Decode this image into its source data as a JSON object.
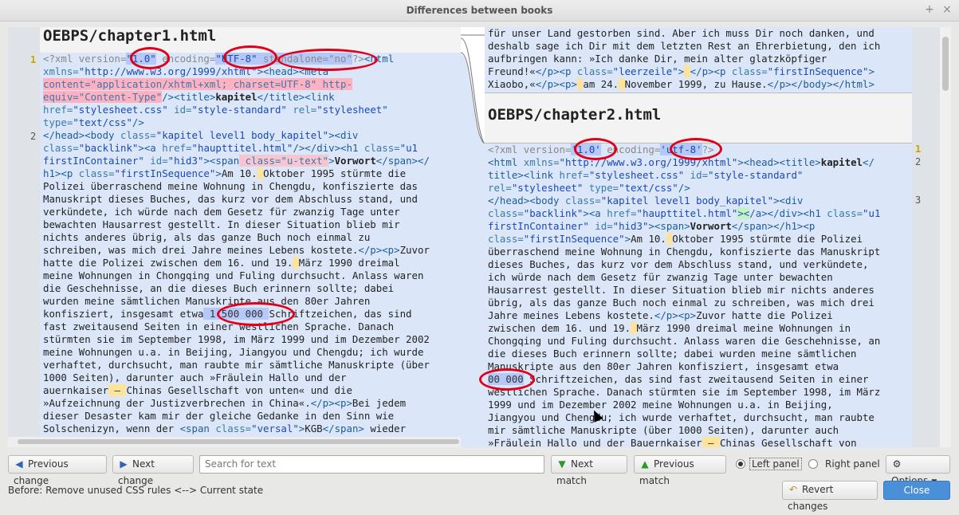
{
  "window": {
    "title": "Differences between books",
    "min_icon": "+",
    "close_icon": "×"
  },
  "left": {
    "filename": "OEBPS/chapter1.html",
    "gutter": [
      "1",
      "2"
    ],
    "lines": [
      [
        [
          "pi",
          "<?xml version="
        ],
        [
          "chg t-str",
          "\"1.0\""
        ],
        [
          "pi",
          " encoding="
        ],
        [
          "chg t-str",
          "\"UTF-8\""
        ],
        [
          "chg t-pi",
          " standalone=\"no\""
        ],
        [
          "pi",
          "?>"
        ],
        [
          "tag",
          "<html"
        ]
      ],
      [
        [
          "attr",
          "xmlns="
        ],
        [
          "str",
          "\"http://www.w3.org/1999/xhtml\""
        ],
        [
          "tag",
          "><head><meta"
        ]
      ],
      [
        [
          "del",
          "content=\"application/xhtml+xml; charset=UTF-8\" http-"
        ]
      ],
      [
        [
          "del",
          "equiv=\"Content-Type\""
        ],
        [
          "tag",
          "/><title>"
        ],
        [
          "bold",
          "kapitel"
        ],
        [
          "tag",
          "</title><link"
        ]
      ],
      [
        [
          "attr",
          "href="
        ],
        [
          "str",
          "\"stylesheet.css\""
        ],
        [
          "attr",
          " id="
        ],
        [
          "str",
          "\"style-standard\""
        ],
        [
          "attr",
          " rel="
        ],
        [
          "str",
          "\"stylesheet\""
        ]
      ],
      [
        [
          "attr",
          "type="
        ],
        [
          "str",
          "\"text/css\""
        ],
        [
          "tag",
          "/>"
        ]
      ],
      [
        [
          "tag",
          "</head><body"
        ],
        [
          "attr",
          " class="
        ],
        [
          "str",
          "\"kapitel level1 body_kapitel\""
        ],
        [
          "tag",
          "><div"
        ]
      ],
      [
        [
          "attr",
          "class="
        ],
        [
          "str",
          "\"backlink\""
        ],
        [
          "tag",
          "><a"
        ],
        [
          "attr",
          " href="
        ],
        [
          "str",
          "\"haupttitel.html\""
        ],
        [
          "tag",
          "/></div><h1"
        ],
        [
          "attr",
          " class="
        ],
        [
          "str",
          "\"u1"
        ]
      ],
      [
        [
          "str",
          "firstInContainer\""
        ],
        [
          "attr",
          " id="
        ],
        [
          "str",
          "\"hid3\""
        ],
        [
          "tag",
          "><span"
        ],
        [
          "rd",
          " class=\"u-text\""
        ],
        [
          "tag",
          ">"
        ],
        [
          "bold",
          "Vorwort"
        ],
        [
          "tag",
          "</span></"
        ]
      ],
      [
        [
          "tag",
          "h1><p"
        ],
        [
          "attr",
          " class="
        ],
        [
          "str",
          "\"firstInSequence\""
        ],
        [
          "tag",
          ">"
        ],
        [
          "txt",
          "Am 10."
        ],
        [
          "dot",
          " "
        ],
        [
          "txt",
          "Oktober 1995 stürmte die"
        ]
      ],
      [
        [
          "txt",
          "Polizei überraschend meine Wohnung in Chengdu, konfiszierte das"
        ]
      ],
      [
        [
          "txt",
          "Manuskript dieses Buches, das kurz vor dem Abschluss stand, und"
        ]
      ],
      [
        [
          "txt",
          "verkündete, ich würde nach dem Gesetz für zwanzig Tage unter"
        ]
      ],
      [
        [
          "txt",
          "bewachten Hausarrest gestellt. In dieser Situation blieb mir"
        ]
      ],
      [
        [
          "txt",
          "nichts anderes übrig, als das ganze Buch noch einmal zu"
        ]
      ],
      [
        [
          "txt",
          "schreiben, was mich drei Jahre meines Lebens kostete."
        ],
        [
          "tag",
          "</p><p>"
        ],
        [
          "txt",
          "Zuvor"
        ]
      ],
      [
        [
          "txt",
          "hatte die Polizei zwischen dem 16. und 19."
        ],
        [
          "dot",
          " "
        ],
        [
          "txt",
          "März 1990 dreimal"
        ]
      ],
      [
        [
          "txt",
          "meine Wohnungen in Chongqing und Fuling durchsucht. Anlass waren"
        ]
      ],
      [
        [
          "txt",
          "die Geschehnisse, an die dieses Buch erinnern sollte; dabei"
        ]
      ],
      [
        [
          "txt",
          "wurden meine sämtlichen Manuskripte aus den 80er Jahren"
        ]
      ],
      [
        [
          "txt",
          "konfisziert, insgesamt etwa"
        ],
        [
          "chg",
          " 1 500 000 "
        ],
        [
          "txt",
          "Schriftzeichen, das sind"
        ]
      ],
      [
        [
          "txt",
          "fast zweitausend Seiten in einer westlichen Sprache. Danach"
        ]
      ],
      [
        [
          "txt",
          "stürmten sie im September 1998, im März 1999 und im Dezember 2002"
        ]
      ],
      [
        [
          "txt",
          "meine Wohnungen u.a. in Beijing, Jiangyou und Chengdu; ich wurde"
        ]
      ],
      [
        [
          "txt",
          "verhaftet, durchsucht, man raubte mir sämtliche Manuskripte (über"
        ]
      ],
      [
        [
          "txt",
          "1000 Seiten), darunter auch »Fräulein Hallo und der"
        ]
      ],
      [
        [
          "txt",
          "auernkaiser"
        ],
        [
          "dot",
          " – "
        ],
        [
          "txt",
          "Chinas Gesellschaft von unten« und die"
        ]
      ],
      [
        [
          "txt",
          "»Aufzeichnung der Justizverbrechen in China«."
        ],
        [
          "tag",
          "</p><p>"
        ],
        [
          "txt",
          "Bei jedem"
        ]
      ],
      [
        [
          "txt",
          "dieser Desaster kam mir der gleiche Gedanke in den Sinn wie"
        ]
      ],
      [
        [
          "txt",
          "Solschenizyn, wenn der "
        ],
        [
          "tag",
          "<span"
        ],
        [
          "attr",
          " class="
        ],
        [
          "str",
          "\"versal\""
        ],
        [
          "tag",
          ">"
        ],
        [
          "txt",
          "KGB"
        ],
        [
          "tag",
          "</span>"
        ],
        [
          "txt",
          " wieder"
        ]
      ]
    ]
  },
  "right": {
    "filename": "OEBPS/chapter2.html",
    "gutter": [
      "1",
      "2",
      "3"
    ],
    "top_lines": [
      [
        [
          "txt",
          "für unser Land gestorben sind. Aber ich muss Dir noch danken, und"
        ]
      ],
      [
        [
          "txt",
          "deshalb sage ich Dir mit dem letzten Rest an Ehrerbietung, den ich"
        ]
      ],
      [
        [
          "txt",
          "aufbringen kann: »Ich danke Dir, mein alter glatzköpfiger"
        ]
      ],
      [
        [
          "txt",
          "Freund!«"
        ],
        [
          "tag",
          "</p><p"
        ],
        [
          "attr",
          " class="
        ],
        [
          "str",
          "\"leerzeile\""
        ],
        [
          "tag",
          ">"
        ],
        [
          "dot",
          " "
        ],
        [
          "tag",
          "</p><p"
        ],
        [
          "attr",
          " class="
        ],
        [
          "str",
          "\"firstInSequence\""
        ],
        [
          "tag",
          ">"
        ]
      ],
      [
        [
          "txt",
          "Xiaobo,«"
        ],
        [
          "tag",
          "</p><p>"
        ],
        [
          "dot",
          " "
        ],
        [
          "txt",
          "am 24."
        ],
        [
          "dot",
          " "
        ],
        [
          "txt",
          "November 1999, zu Hause."
        ],
        [
          "tag",
          "</p></body></html>"
        ]
      ]
    ],
    "lines": [
      [
        [
          "pi",
          "<?xml version="
        ],
        [
          "chg t-str",
          "'1.0'"
        ],
        [
          "pi",
          " encoding="
        ],
        [
          "chg t-str",
          "'utf-8'"
        ],
        [
          "pi",
          "?>"
        ]
      ],
      [
        [
          "tag",
          "<html"
        ],
        [
          "attr",
          " xmlns="
        ],
        [
          "str",
          "\"http://www.w3.org/1999/xhtml\""
        ],
        [
          "tag",
          "><head><title>"
        ],
        [
          "bold",
          "kapitel"
        ],
        [
          "tag",
          "</"
        ]
      ],
      [
        [
          "tag",
          "title><link"
        ],
        [
          "attr",
          " href="
        ],
        [
          "str",
          "\"stylesheet.css\""
        ],
        [
          "attr",
          " id="
        ],
        [
          "str",
          "\"style-standard\""
        ]
      ],
      [
        [
          "attr",
          "rel="
        ],
        [
          "str",
          "\"stylesheet\""
        ],
        [
          "attr",
          " type="
        ],
        [
          "str",
          "\"text/css\""
        ],
        [
          "tag",
          "/>"
        ]
      ],
      [
        [
          "tag",
          "</head><body"
        ],
        [
          "attr",
          " class="
        ],
        [
          "str",
          "\"kapitel level1 body_kapitel\""
        ],
        [
          "tag",
          "><div"
        ]
      ],
      [
        [
          "attr",
          "class="
        ],
        [
          "str",
          "\"backlink\""
        ],
        [
          "tag",
          "><a"
        ],
        [
          "attr",
          " href="
        ],
        [
          "str",
          "\"haupttitel.html\""
        ],
        [
          "ins",
          "><"
        ],
        [
          "tag",
          "/a></div><h1"
        ],
        [
          "attr",
          " class="
        ],
        [
          "str",
          "\"u1"
        ]
      ],
      [
        [
          "str",
          "firstInContainer\""
        ],
        [
          "attr",
          " id="
        ],
        [
          "str",
          "\"hid3\""
        ],
        [
          "tag",
          "><span>"
        ],
        [
          "bold",
          "Vorwort"
        ],
        [
          "tag",
          "</span></h1><p"
        ]
      ],
      [
        [
          "attr",
          "class="
        ],
        [
          "str",
          "\"firstInSequence\""
        ],
        [
          "tag",
          ">"
        ],
        [
          "txt",
          "Am 10."
        ],
        [
          "dot",
          " "
        ],
        [
          "txt",
          "Oktober 1995 stürmte die Polizei"
        ]
      ],
      [
        [
          "txt",
          "überraschend meine Wohnung in Chengdu, konfiszierte das Manuskript"
        ]
      ],
      [
        [
          "txt",
          "dieses Buches, das kurz vor dem Abschluss stand, und verkündete,"
        ]
      ],
      [
        [
          "txt",
          "ich würde nach dem Gesetz für zwanzig Tage unter bewachten"
        ]
      ],
      [
        [
          "txt",
          "Hausarrest gestellt. In dieser Situation blieb mir nichts anderes"
        ]
      ],
      [
        [
          "txt",
          "übrig, als das ganze Buch noch einmal zu schreiben, was mich drei"
        ]
      ],
      [
        [
          "txt",
          "Jahre meines Lebens kostete."
        ],
        [
          "tag",
          "</p><p>"
        ],
        [
          "txt",
          "Zuvor hatte die Polizei"
        ]
      ],
      [
        [
          "txt",
          "zwischen dem 16. und 19."
        ],
        [
          "dot",
          " "
        ],
        [
          "txt",
          "März 1990 dreimal meine Wohnungen in"
        ]
      ],
      [
        [
          "txt",
          "Chongqing und Fuling durchsucht. Anlass waren die Geschehnisse, an"
        ]
      ],
      [
        [
          "txt",
          "die dieses Buch erinnern sollte; dabei wurden meine sämtlichen"
        ]
      ],
      [
        [
          "txt",
          "Manuskripte aus den 80er Jahren konfisziert, insgesamt etwa"
        ]
      ],
      [
        [
          "chg",
          "00 000"
        ],
        [
          "txt",
          " Schriftzeichen, das sind fast zweitausend Seiten in einer"
        ]
      ],
      [
        [
          "txt",
          "westlichen Sprache. Danach stürmten sie im September 1998, im März"
        ]
      ],
      [
        [
          "txt",
          "1999 und im Dezember 2002 meine Wohnungen u.a. in Beijing,"
        ]
      ],
      [
        [
          "txt",
          "Jiangyou und Chengdu; ich wurde verhaftet, durchsucht, man raubte"
        ]
      ],
      [
        [
          "txt",
          "mir sämtliche Manuskripte (über 1000 Seiten), darunter auch"
        ]
      ],
      [
        [
          "txt",
          "»Fräulein Hallo und der Bauernkaiser"
        ],
        [
          "dot",
          " – "
        ],
        [
          "txt",
          "Chinas Gesellschaft von"
        ]
      ]
    ]
  },
  "toolbar": {
    "prev_change": "Previous change",
    "next_change": "Next change",
    "search_placeholder": "Search for text",
    "next_match": "Next match",
    "prev_match": "Previous match",
    "left_panel": "Left panel",
    "right_panel": "Right panel",
    "options": "Options"
  },
  "footer": {
    "status": "Before: Remove unused CSS rules <--> Current state",
    "revert": "Revert changes",
    "close": "Close"
  }
}
